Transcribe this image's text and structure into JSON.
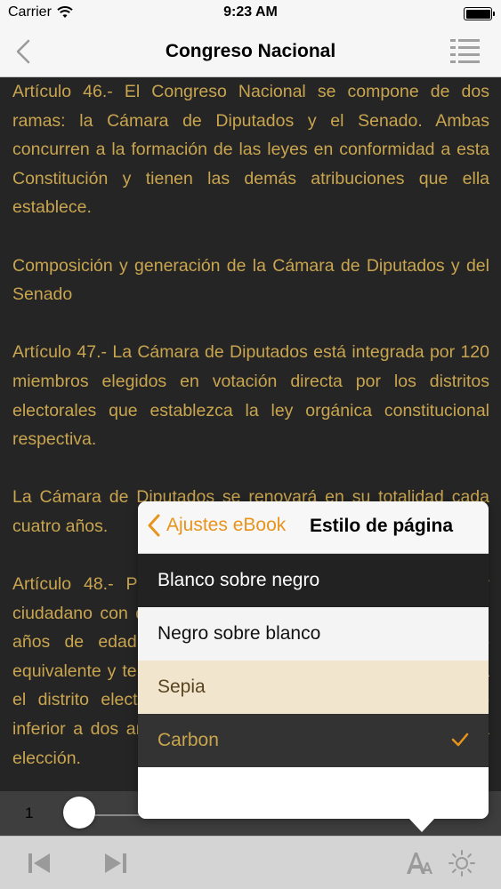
{
  "status_bar": {
    "carrier": "Carrier",
    "time": "9:23 AM"
  },
  "nav": {
    "title": "Congreso Nacional",
    "back_icon": "chevron-left-icon",
    "toc_icon": "list-icon"
  },
  "content": {
    "paragraphs": [
      "Artículo 46.- El Congreso Nacional se compone de dos ramas: la Cámara de Diputados y el Senado. Ambas concurren a la formación de las leyes en conformidad a esta Constitución y tienen las demás atribuciones que ella establece.",
      "Composición y generación de la Cámara de Diputados y del Senado",
      "Artículo 47.- La Cámara de Diputados está integrada por 120 miembros elegidos en votación directa por los distritos electorales que establezca la ley orgánica constitucional respectiva.",
      "La Cámara de Diputados se renovará en su totalidad cada cuatro años.",
      "Artículo 48.- Para ser elegido diputado se requiere ser ciudadano con derecho a sufragio, tener cumplidos veintiún años de edad, haber cursado la enseñanza media o equivalente y tener residencia en la región a que pertenezca el distrito electoral correspondiente durante un plazo no inferior a dos años, contado hacia atrás desde el día de la elección."
    ]
  },
  "popover": {
    "back_label": "Ajustes eBook",
    "title": "Estilo de página",
    "options": [
      {
        "label": "Blanco sobre negro",
        "selected": false
      },
      {
        "label": "Negro sobre blanco",
        "selected": false
      },
      {
        "label": "Sepia",
        "selected": false
      },
      {
        "label": "Carbon",
        "selected": true
      }
    ]
  },
  "slider": {
    "page": "1",
    "position": 0.0
  },
  "toolbar": {
    "icons": [
      "skip-back-icon",
      "skip-forward-icon",
      "font-size-icon",
      "brightness-icon"
    ]
  },
  "colors": {
    "accent": "#e8941c",
    "text": "#c9a54f",
    "background": "#252525"
  }
}
